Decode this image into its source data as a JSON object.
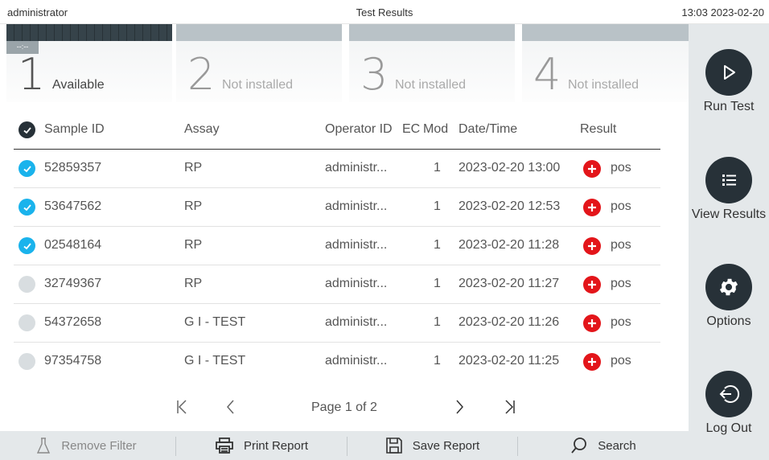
{
  "topbar": {
    "user": "administrator",
    "title": "Test Results",
    "datetime": "13:03 2023-02-20"
  },
  "modules": [
    {
      "number": "1",
      "status": "Available",
      "timer": "--:--"
    },
    {
      "number": "2",
      "status": "Not installed"
    },
    {
      "number": "3",
      "status": "Not installed"
    },
    {
      "number": "4",
      "status": "Not installed"
    }
  ],
  "sidebar": {
    "run_test": "Run Test",
    "view_results": "View Results",
    "options": "Options",
    "log_out": "Log Out"
  },
  "table": {
    "headers": {
      "sample_id": "Sample ID",
      "assay": "Assay",
      "operator_id": "Operator ID",
      "ec": "EC",
      "mod": "Mod",
      "datetime": "Date/Time",
      "result": "Result"
    },
    "rows": [
      {
        "selected": true,
        "sample_id": "52859357",
        "assay": "RP",
        "operator": "administr...",
        "mod": "1",
        "datetime": "2023-02-20 13:00",
        "result": "pos"
      },
      {
        "selected": true,
        "sample_id": "53647562",
        "assay": "RP",
        "operator": "administr...",
        "mod": "1",
        "datetime": "2023-02-20 12:53",
        "result": "pos"
      },
      {
        "selected": true,
        "sample_id": "02548164",
        "assay": "RP",
        "operator": "administr...",
        "mod": "1",
        "datetime": "2023-02-20 11:28",
        "result": "pos"
      },
      {
        "selected": false,
        "sample_id": "32749367",
        "assay": "RP",
        "operator": "administr...",
        "mod": "1",
        "datetime": "2023-02-20 11:27",
        "result": "pos"
      },
      {
        "selected": false,
        "sample_id": "54372658",
        "assay": "G I - TEST",
        "operator": "administr...",
        "mod": "1",
        "datetime": "2023-02-20 11:26",
        "result": "pos"
      },
      {
        "selected": false,
        "sample_id": "97354758",
        "assay": "G I - TEST",
        "operator": "administr...",
        "mod": "1",
        "datetime": "2023-02-20 11:25",
        "result": "pos"
      }
    ]
  },
  "pager": {
    "text": "Page 1 of 2"
  },
  "toolbar": {
    "remove_filter": "Remove Filter",
    "print_report": "Print Report",
    "save_report": "Save Report",
    "search": "Search"
  },
  "colors": {
    "accent_dark": "#273138",
    "selected_check": "#1ab3ec",
    "positive_red": "#e3151a",
    "sidebar_bg": "#e4e8ea"
  }
}
